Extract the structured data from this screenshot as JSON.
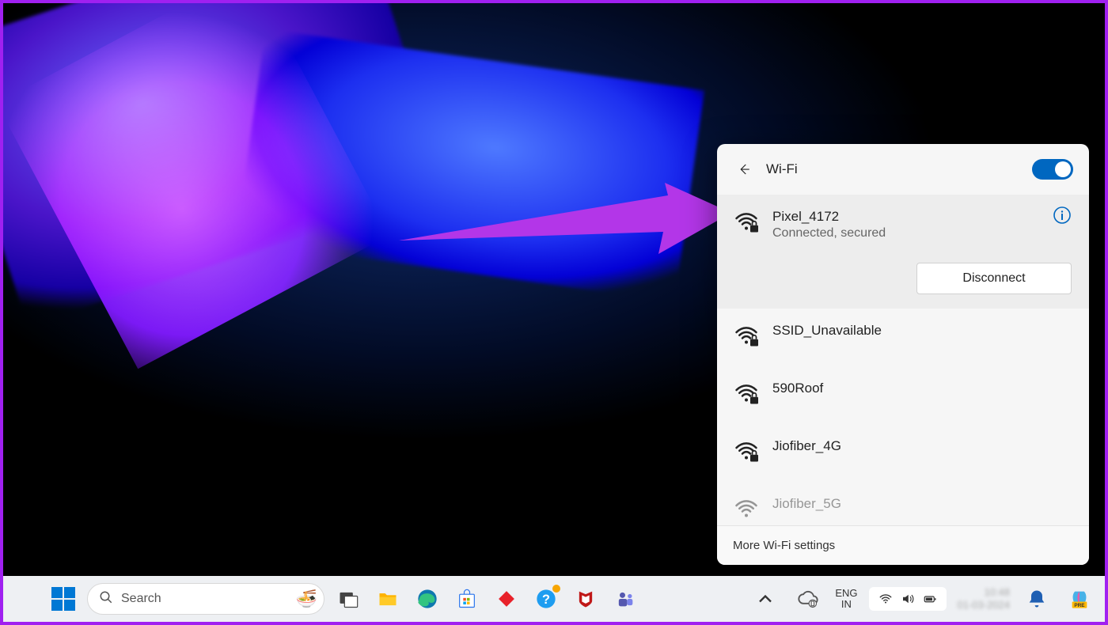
{
  "wifi_flyout": {
    "title": "Wi-Fi",
    "toggle_on": true,
    "connected": {
      "ssid": "Pixel_4172",
      "status": "Connected, secured",
      "disconnect_label": "Disconnect"
    },
    "networks": [
      {
        "ssid": "SSID_Unavailable",
        "secured": true
      },
      {
        "ssid": "590Roof",
        "secured": true
      },
      {
        "ssid": "Jiofiber_4G",
        "secured": true
      },
      {
        "ssid": "Jiofiber_5G",
        "secured": true,
        "partial": true
      }
    ],
    "more_label": "More Wi-Fi settings"
  },
  "taskbar": {
    "search_placeholder": "Search",
    "lang_top": "ENG",
    "lang_bot": "IN",
    "time": "10:48",
    "date": "01-03-2024"
  },
  "icons": {
    "back": "back-arrow-icon",
    "info": "info-circle-icon",
    "wifi_lock": "wifi-secured-icon",
    "start": "windows-start-icon"
  }
}
